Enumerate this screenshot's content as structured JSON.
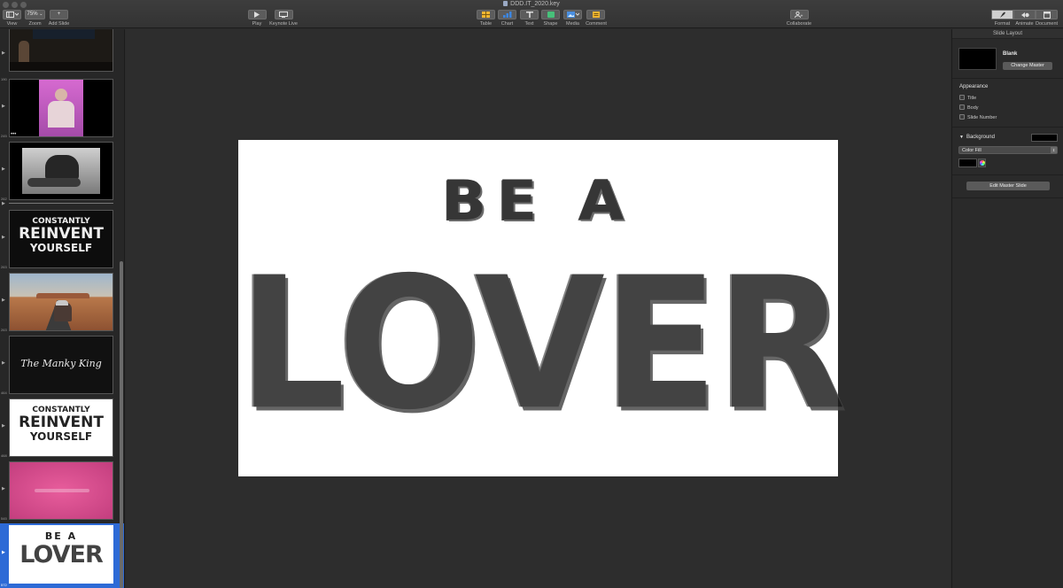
{
  "window": {
    "title": "DDD.IT_2020.key"
  },
  "toolbar": {
    "view": "View",
    "zoom": "Zoom",
    "zoom_value": "75%",
    "add_slide": "Add Slide",
    "play": "Play",
    "keynote_live": "Keynote Live",
    "table": "Table",
    "chart": "Chart",
    "text": "Text",
    "shape": "Shape",
    "media": "Media",
    "comment": "Comment",
    "collaborate": "Collaborate",
    "format": "Format",
    "animate": "Animate",
    "document": "Document"
  },
  "navigator": {
    "slides": [
      {
        "number": "190",
        "kind": "stage-photo"
      },
      {
        "number": "245",
        "kind": "pink-photo"
      },
      {
        "number": "262",
        "kind": "bw-photo"
      },
      {
        "number": "263",
        "kind": "lettering",
        "lines": [
          "CONSTANTLY",
          "REINVENT",
          "YOURSELF"
        ]
      },
      {
        "number": "263",
        "kind": "road-photo"
      },
      {
        "number": "464",
        "kind": "lettering-dark",
        "lines": [
          "The Manky King"
        ]
      },
      {
        "number": "468",
        "kind": "lettering",
        "lines": [
          "CONSTANTLY",
          "REINVENT",
          "YOURSELF"
        ]
      },
      {
        "number": "545",
        "kind": "pink-slide"
      },
      {
        "number": "572",
        "kind": "lettering",
        "lines": [
          "BE A",
          "LOVER"
        ],
        "selected": true
      }
    ]
  },
  "slide": {
    "line1": "BE A",
    "line2": "LOVER"
  },
  "inspector": {
    "header": "Slide Layout",
    "master_name": "Blank",
    "change_master": "Change Master",
    "appearance_title": "Appearance",
    "options": [
      "Title",
      "Body",
      "Slide Number"
    ],
    "background_title": "Background",
    "fill_type": "Color Fill",
    "edit_master": "Edit Master Slide"
  },
  "colors": {
    "selection": "#2d6ad6",
    "toolbar": "#3a3a3a",
    "canvas": "#2d2d2d",
    "slide": "#ffffff"
  }
}
